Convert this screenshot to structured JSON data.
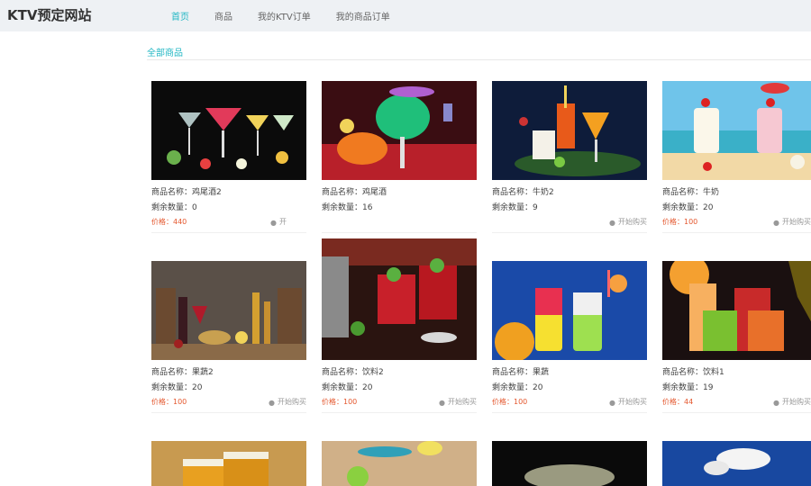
{
  "brand": "KTV预定网站",
  "nav": [
    {
      "label": "首页",
      "active": true
    },
    {
      "label": "商品",
      "active": false
    },
    {
      "label": "我的KTV订单",
      "active": false
    },
    {
      "label": "我的商品订单",
      "active": false
    }
  ],
  "section_title": "全部商品",
  "labels": {
    "name_prefix": "商品名称：",
    "stock_prefix": "剩余数量：",
    "price_prefix": "价格：",
    "buy": "开始购买",
    "buy_partial": "开"
  },
  "products": [
    {
      "name": "鸡尾酒2",
      "stock": "0",
      "price": "440"
    },
    {
      "name": "鸡尾酒",
      "stock": "16",
      "price": ""
    },
    {
      "name": "牛奶2",
      "stock": "9",
      "price": ""
    },
    {
      "name": "牛奶",
      "stock": "20",
      "price": "100"
    },
    {
      "name": "果蔬2",
      "stock": "20",
      "price": "100"
    },
    {
      "name": "饮料2",
      "stock": "20",
      "price": "100"
    },
    {
      "name": "果蔬",
      "stock": "20",
      "price": "100"
    },
    {
      "name": "饮料1",
      "stock": "19",
      "price": "44"
    }
  ],
  "colors": {
    "accent": "#23b7c4",
    "price": "#e4572e",
    "topbar": "#eef1f4"
  }
}
